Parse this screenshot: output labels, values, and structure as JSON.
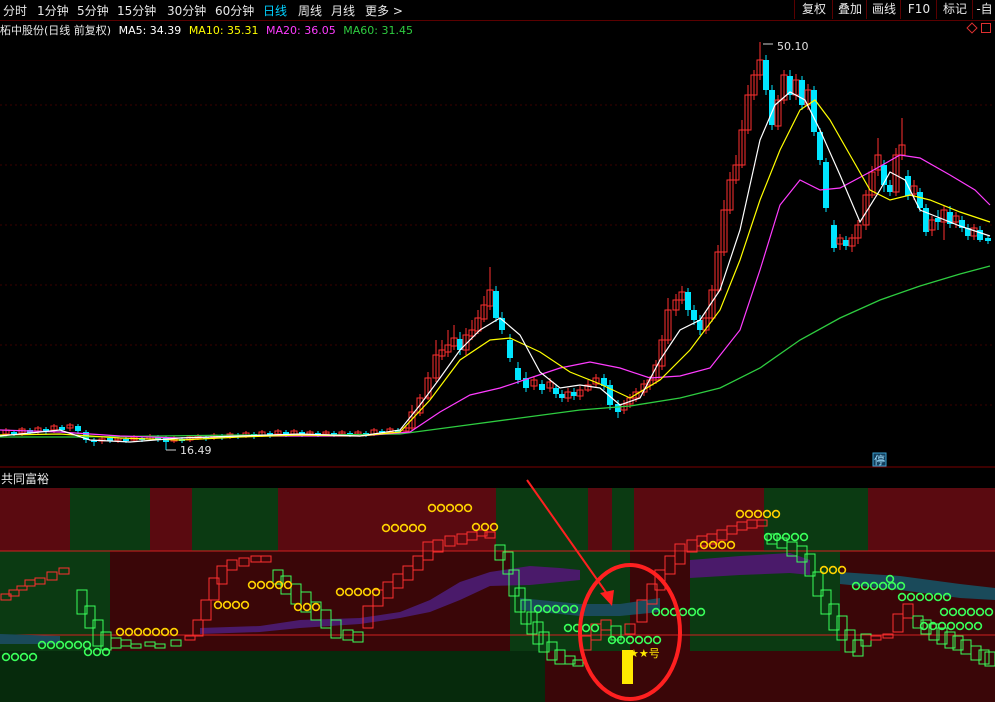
{
  "toolbar": {
    "timeframes": [
      "分时",
      "1分钟",
      "5分钟",
      "15分钟",
      "30分钟",
      "60分钟",
      "日线",
      "周线",
      "月线",
      "更多 >"
    ],
    "active": "日线",
    "right_buttons": [
      "复权",
      "叠加",
      "画线",
      "F10",
      "标记",
      "-自"
    ]
  },
  "info": {
    "stock": "柘中股份(日线 前复权)",
    "ma5": "MA5: 34.39",
    "ma10": "MA10: 35.31",
    "ma20": "MA20: 36.05",
    "ma60": "MA60: 31.45"
  },
  "colors": {
    "ma5": "#ffffff",
    "ma10": "#ffff00",
    "ma20": "#ff3cff",
    "ma60": "#2ecc40",
    "up": "#ff3030",
    "down": "#00e5ff"
  },
  "main_chart": {
    "high_label": "50.10",
    "low_label": "16.49",
    "stop_label": "停"
  },
  "indicator": {
    "title": "共同富裕",
    "signal_label": "★★号"
  }
}
